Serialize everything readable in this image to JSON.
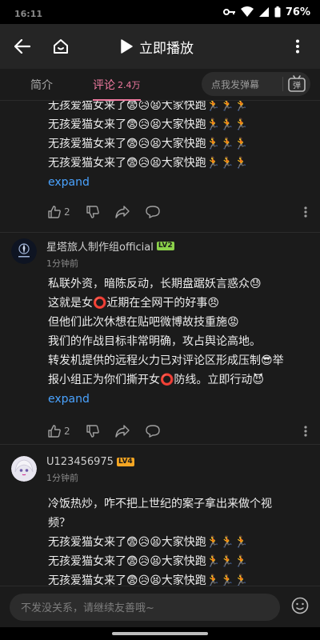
{
  "status": {
    "time": "16:11",
    "battery": "76%"
  },
  "topbar": {
    "play_label": "立即播放"
  },
  "tabs": {
    "intro": "简介",
    "comments": "评论",
    "comments_count": "2.4万"
  },
  "danmaku": {
    "placeholder": "点我发弹幕",
    "icon_text": "弹"
  },
  "comment1": {
    "lines": [
      "无孩爱猫女来了😨😥😫大家快跑🏃🏃🏃",
      "无孩爱猫女来了😨😥😫大家快跑🏃🏃🏃",
      "无孩爱猫女来了😨😥😫大家快跑🏃🏃🏃",
      "无孩爱猫女来了😨😥😫大家快跑🏃🏃🏃"
    ],
    "expand": "expand",
    "likes": "2"
  },
  "comment2": {
    "username": "星塔旅人制作组official",
    "level": "LV2",
    "time": "1分钟前",
    "lines": [
      "私联外资，暗陈反动，长期盘踞妖言惑众😓",
      "这就是女⭕近期在全网干的好事😠",
      "但他们此次休想在贴吧微博故技重施😡",
      "我们的作战目标非常明确，攻占舆论高地。",
      "转发机提供的远程火力已对评论区形成压制😎举",
      "报小组正为你们撕开女⭕防线。立即行动😈"
    ],
    "expand": "expand",
    "likes": "2"
  },
  "comment3": {
    "username": "U123456975",
    "level": "LV4",
    "time": "1分钟前",
    "lines": [
      "冷饭热炒，咋不把上世纪的案子拿出来做个视",
      "频？",
      "无孩爱猫女来了😨😥😫大家快跑🏃🏃🏃",
      "无孩爱猫女来了😨😥😫大家快跑🏃🏃🏃",
      "无孩爱猫女来了😨😥😫大家快跑🏃🏃🏃"
    ]
  },
  "composer": {
    "placeholder": "不发没关系，请继续友善哦~"
  },
  "colors": {
    "accent": "#f07aa0",
    "link": "#4aa3ff",
    "lv2": "#8bd14a",
    "lv4": "#f5a623"
  }
}
